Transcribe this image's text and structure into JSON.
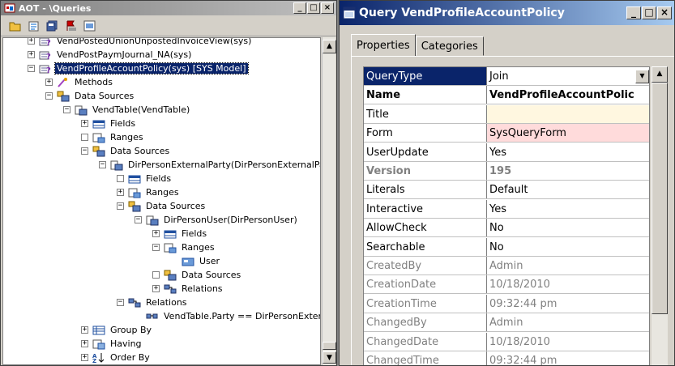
{
  "aot_window": {
    "title": "AOT - \\Queries",
    "controls": [
      "_",
      "□",
      "×"
    ],
    "tree": [
      {
        "indent": 0,
        "expander": "+",
        "icon": "query-icon",
        "label": "VendPostedUnionUnpostedInvoiceView(sys)",
        "partial": true
      },
      {
        "indent": 0,
        "expander": "+",
        "icon": "query-icon",
        "label": "VendPostPaymJournal_NA(sys)"
      },
      {
        "indent": 0,
        "expander": "−",
        "icon": "query-icon",
        "label": "VendProfileAccountPolicy(sys) [SYS Model]",
        "selected": true
      },
      {
        "indent": 1,
        "expander": "+",
        "icon": "methods-icon",
        "label": "Methods"
      },
      {
        "indent": 1,
        "expander": "−",
        "icon": "datasources-icon",
        "label": "Data Sources"
      },
      {
        "indent": 2,
        "expander": "−",
        "icon": "datasource-icon",
        "label": "VendTable(VendTable)"
      },
      {
        "indent": 3,
        "expander": "+",
        "icon": "fields-icon",
        "label": "Fields"
      },
      {
        "indent": 3,
        "expander": " ",
        "icon": "ranges-icon",
        "label": "Ranges"
      },
      {
        "indent": 3,
        "expander": "−",
        "icon": "datasources-icon",
        "label": "Data Sources"
      },
      {
        "indent": 4,
        "expander": "−",
        "icon": "datasource-icon",
        "label": "DirPersonExternalParty(DirPersonExternalParty)"
      },
      {
        "indent": 5,
        "expander": " ",
        "icon": "fields-icon",
        "label": "Fields"
      },
      {
        "indent": 5,
        "expander": "+",
        "icon": "ranges-icon",
        "label": "Ranges"
      },
      {
        "indent": 5,
        "expander": "−",
        "icon": "datasources-icon",
        "label": "Data Sources"
      },
      {
        "indent": 6,
        "expander": "−",
        "icon": "datasource-icon",
        "label": "DirPersonUser(DirPersonUser)"
      },
      {
        "indent": 7,
        "expander": "+",
        "icon": "fields-icon",
        "label": "Fields"
      },
      {
        "indent": 7,
        "expander": "−",
        "icon": "ranges-icon",
        "label": "Ranges"
      },
      {
        "indent": 8,
        "expander": "",
        "icon": "range-field-icon",
        "label": "User"
      },
      {
        "indent": 7,
        "expander": " ",
        "icon": "datasources-icon",
        "label": "Data Sources"
      },
      {
        "indent": 7,
        "expander": "+",
        "icon": "relations-icon",
        "label": "Relations"
      },
      {
        "indent": 5,
        "expander": "−",
        "icon": "relations-icon",
        "label": "Relations"
      },
      {
        "indent": 6,
        "expander": "",
        "icon": "relation-icon",
        "label": "VendTable.Party == DirPersonExternalParty"
      },
      {
        "indent": 3,
        "expander": "+",
        "icon": "groupby-icon",
        "label": "Group By"
      },
      {
        "indent": 3,
        "expander": "+",
        "icon": "having-icon",
        "label": "Having"
      },
      {
        "indent": 3,
        "expander": "+",
        "icon": "orderby-icon",
        "label": "Order By"
      }
    ]
  },
  "query_window": {
    "title": "Query VendProfileAccountPolicy",
    "controls": [
      "_",
      "□",
      "×"
    ],
    "tabs": [
      "Properties",
      "Categories"
    ],
    "active_tab": "Properties",
    "properties": [
      {
        "name": "QueryType",
        "value": "Join",
        "style": "hdr",
        "dropdown": true
      },
      {
        "name": "Name",
        "value": "VendProfileAccountPolic",
        "style": "bold"
      },
      {
        "name": "Title",
        "value": "",
        "style": "normal",
        "value_bg": "cream"
      },
      {
        "name": "Form",
        "value": "SysQueryForm",
        "style": "normal",
        "value_bg": "pink"
      },
      {
        "name": "UserUpdate",
        "value": "Yes",
        "style": "normal"
      },
      {
        "name": "Version",
        "value": "195",
        "style": "grayb"
      },
      {
        "name": "Literals",
        "value": "Default",
        "style": "normal"
      },
      {
        "name": "Interactive",
        "value": "Yes",
        "style": "normal"
      },
      {
        "name": "AllowCheck",
        "value": "No",
        "style": "normal"
      },
      {
        "name": "Searchable",
        "value": "No",
        "style": "normal"
      },
      {
        "name": "CreatedBy",
        "value": "Admin",
        "style": "dis"
      },
      {
        "name": "CreationDate",
        "value": "10/18/2010",
        "style": "dis"
      },
      {
        "name": "CreationTime",
        "value": "09:32:44 pm",
        "style": "dis"
      },
      {
        "name": "ChangedBy",
        "value": "Admin",
        "style": "dis"
      },
      {
        "name": "ChangedDate",
        "value": "10/18/2010",
        "style": "dis"
      },
      {
        "name": "ChangedTime",
        "value": "09:32:44 pm",
        "style": "dis"
      }
    ]
  },
  "colors": {
    "selection": "#0a246a",
    "title_active": "#0a246a",
    "face": "#d4d0c8",
    "pink_value": "#ffdbdb"
  }
}
